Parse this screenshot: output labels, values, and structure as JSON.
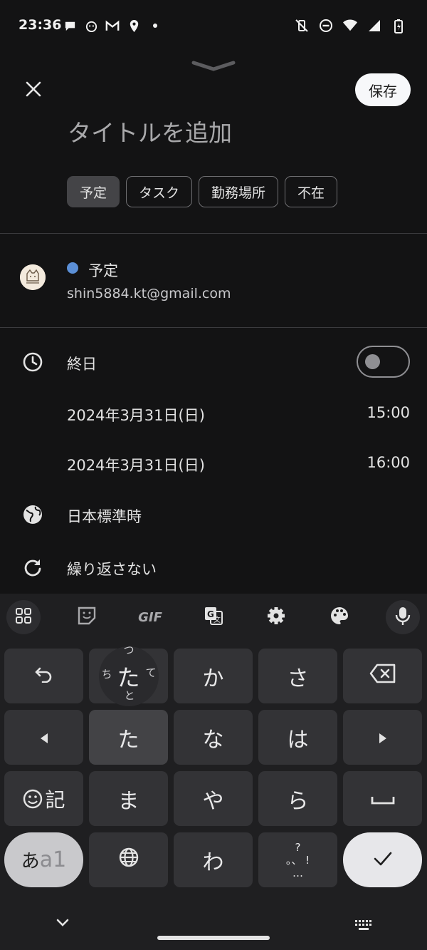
{
  "status_bar": {
    "time": "23:36",
    "left_icons": [
      "chat-bubble-icon",
      "cat-face-icon",
      "gmail-icon",
      "location-pin-icon",
      "dot-icon"
    ],
    "right_icons": [
      "mute-vibrate-icon",
      "do-not-disturb-icon",
      "wifi-icon",
      "signal-icon",
      "battery-charging-icon"
    ]
  },
  "header": {
    "save_label": "保存",
    "title_placeholder": "タイトルを追加",
    "chips": [
      "予定",
      "タスク",
      "勤務場所",
      "不在"
    ],
    "selected_chip": "予定"
  },
  "account": {
    "calendar_name": "予定",
    "calendar_color": "#5b8fd6",
    "email": "shin5884.kt@gmail.com"
  },
  "event": {
    "all_day_label": "終日",
    "all_day_on": false,
    "start_date": "2024年3月31日(日)",
    "start_time": "15:00",
    "end_date": "2024年3月31日(日)",
    "end_time": "16:00",
    "timezone": "日本標準時",
    "repeat": "繰り返さない"
  },
  "keyboard": {
    "toolbar_gif": "GIF",
    "flick_center": "た",
    "flick_up": "つ",
    "flick_left": "ち",
    "flick_right": "て",
    "flick_down": "と",
    "row1": [
      "か",
      "さ"
    ],
    "row2": [
      "た",
      "な",
      "は"
    ],
    "symbol_key": "記",
    "row3": [
      "ま",
      "や",
      "ら"
    ],
    "mode_key_kana": "あ",
    "mode_key_alpha": "a1",
    "wa_key": "わ",
    "punct_top": "?",
    "punct_mid": "。、 !",
    "punct_bottom": "…"
  },
  "colors": {
    "background": "#131314",
    "keyboard_bg": "#1f1f21",
    "accent_blue": "#5b8fd6"
  }
}
